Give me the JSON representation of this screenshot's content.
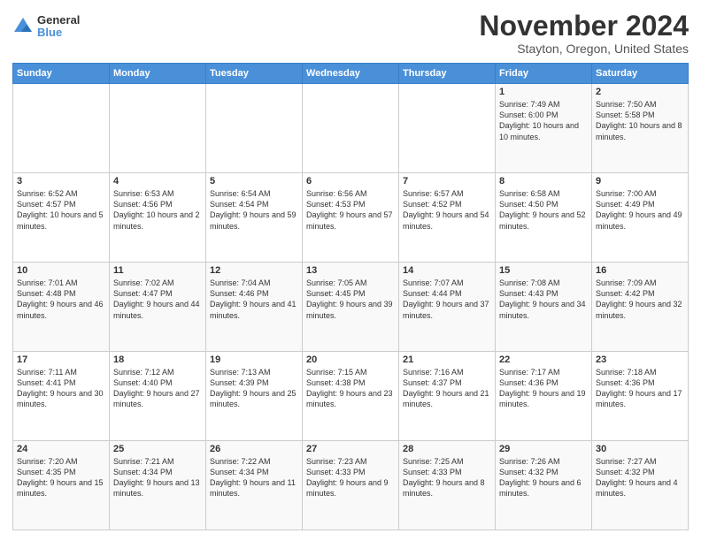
{
  "header": {
    "logo_general": "General",
    "logo_blue": "Blue",
    "month_title": "November 2024",
    "subtitle": "Stayton, Oregon, United States"
  },
  "days_of_week": [
    "Sunday",
    "Monday",
    "Tuesday",
    "Wednesday",
    "Thursday",
    "Friday",
    "Saturday"
  ],
  "weeks": [
    [
      {
        "day": "",
        "info": ""
      },
      {
        "day": "",
        "info": ""
      },
      {
        "day": "",
        "info": ""
      },
      {
        "day": "",
        "info": ""
      },
      {
        "day": "",
        "info": ""
      },
      {
        "day": "1",
        "info": "Sunrise: 7:49 AM\nSunset: 6:00 PM\nDaylight: 10 hours\nand 10 minutes."
      },
      {
        "day": "2",
        "info": "Sunrise: 7:50 AM\nSunset: 5:58 PM\nDaylight: 10 hours\nand 8 minutes."
      }
    ],
    [
      {
        "day": "3",
        "info": "Sunrise: 6:52 AM\nSunset: 4:57 PM\nDaylight: 10 hours\nand 5 minutes."
      },
      {
        "day": "4",
        "info": "Sunrise: 6:53 AM\nSunset: 4:56 PM\nDaylight: 10 hours\nand 2 minutes."
      },
      {
        "day": "5",
        "info": "Sunrise: 6:54 AM\nSunset: 4:54 PM\nDaylight: 9 hours\nand 59 minutes."
      },
      {
        "day": "6",
        "info": "Sunrise: 6:56 AM\nSunset: 4:53 PM\nDaylight: 9 hours\nand 57 minutes."
      },
      {
        "day": "7",
        "info": "Sunrise: 6:57 AM\nSunset: 4:52 PM\nDaylight: 9 hours\nand 54 minutes."
      },
      {
        "day": "8",
        "info": "Sunrise: 6:58 AM\nSunset: 4:50 PM\nDaylight: 9 hours\nand 52 minutes."
      },
      {
        "day": "9",
        "info": "Sunrise: 7:00 AM\nSunset: 4:49 PM\nDaylight: 9 hours\nand 49 minutes."
      }
    ],
    [
      {
        "day": "10",
        "info": "Sunrise: 7:01 AM\nSunset: 4:48 PM\nDaylight: 9 hours\nand 46 minutes."
      },
      {
        "day": "11",
        "info": "Sunrise: 7:02 AM\nSunset: 4:47 PM\nDaylight: 9 hours\nand 44 minutes."
      },
      {
        "day": "12",
        "info": "Sunrise: 7:04 AM\nSunset: 4:46 PM\nDaylight: 9 hours\nand 41 minutes."
      },
      {
        "day": "13",
        "info": "Sunrise: 7:05 AM\nSunset: 4:45 PM\nDaylight: 9 hours\nand 39 minutes."
      },
      {
        "day": "14",
        "info": "Sunrise: 7:07 AM\nSunset: 4:44 PM\nDaylight: 9 hours\nand 37 minutes."
      },
      {
        "day": "15",
        "info": "Sunrise: 7:08 AM\nSunset: 4:43 PM\nDaylight: 9 hours\nand 34 minutes."
      },
      {
        "day": "16",
        "info": "Sunrise: 7:09 AM\nSunset: 4:42 PM\nDaylight: 9 hours\nand 32 minutes."
      }
    ],
    [
      {
        "day": "17",
        "info": "Sunrise: 7:11 AM\nSunset: 4:41 PM\nDaylight: 9 hours\nand 30 minutes."
      },
      {
        "day": "18",
        "info": "Sunrise: 7:12 AM\nSunset: 4:40 PM\nDaylight: 9 hours\nand 27 minutes."
      },
      {
        "day": "19",
        "info": "Sunrise: 7:13 AM\nSunset: 4:39 PM\nDaylight: 9 hours\nand 25 minutes."
      },
      {
        "day": "20",
        "info": "Sunrise: 7:15 AM\nSunset: 4:38 PM\nDaylight: 9 hours\nand 23 minutes."
      },
      {
        "day": "21",
        "info": "Sunrise: 7:16 AM\nSunset: 4:37 PM\nDaylight: 9 hours\nand 21 minutes."
      },
      {
        "day": "22",
        "info": "Sunrise: 7:17 AM\nSunset: 4:36 PM\nDaylight: 9 hours\nand 19 minutes."
      },
      {
        "day": "23",
        "info": "Sunrise: 7:18 AM\nSunset: 4:36 PM\nDaylight: 9 hours\nand 17 minutes."
      }
    ],
    [
      {
        "day": "24",
        "info": "Sunrise: 7:20 AM\nSunset: 4:35 PM\nDaylight: 9 hours\nand 15 minutes."
      },
      {
        "day": "25",
        "info": "Sunrise: 7:21 AM\nSunset: 4:34 PM\nDaylight: 9 hours\nand 13 minutes."
      },
      {
        "day": "26",
        "info": "Sunrise: 7:22 AM\nSunset: 4:34 PM\nDaylight: 9 hours\nand 11 minutes."
      },
      {
        "day": "27",
        "info": "Sunrise: 7:23 AM\nSunset: 4:33 PM\nDaylight: 9 hours\nand 9 minutes."
      },
      {
        "day": "28",
        "info": "Sunrise: 7:25 AM\nSunset: 4:33 PM\nDaylight: 9 hours\nand 8 minutes."
      },
      {
        "day": "29",
        "info": "Sunrise: 7:26 AM\nSunset: 4:32 PM\nDaylight: 9 hours\nand 6 minutes."
      },
      {
        "day": "30",
        "info": "Sunrise: 7:27 AM\nSunset: 4:32 PM\nDaylight: 9 hours\nand 4 minutes."
      }
    ]
  ]
}
